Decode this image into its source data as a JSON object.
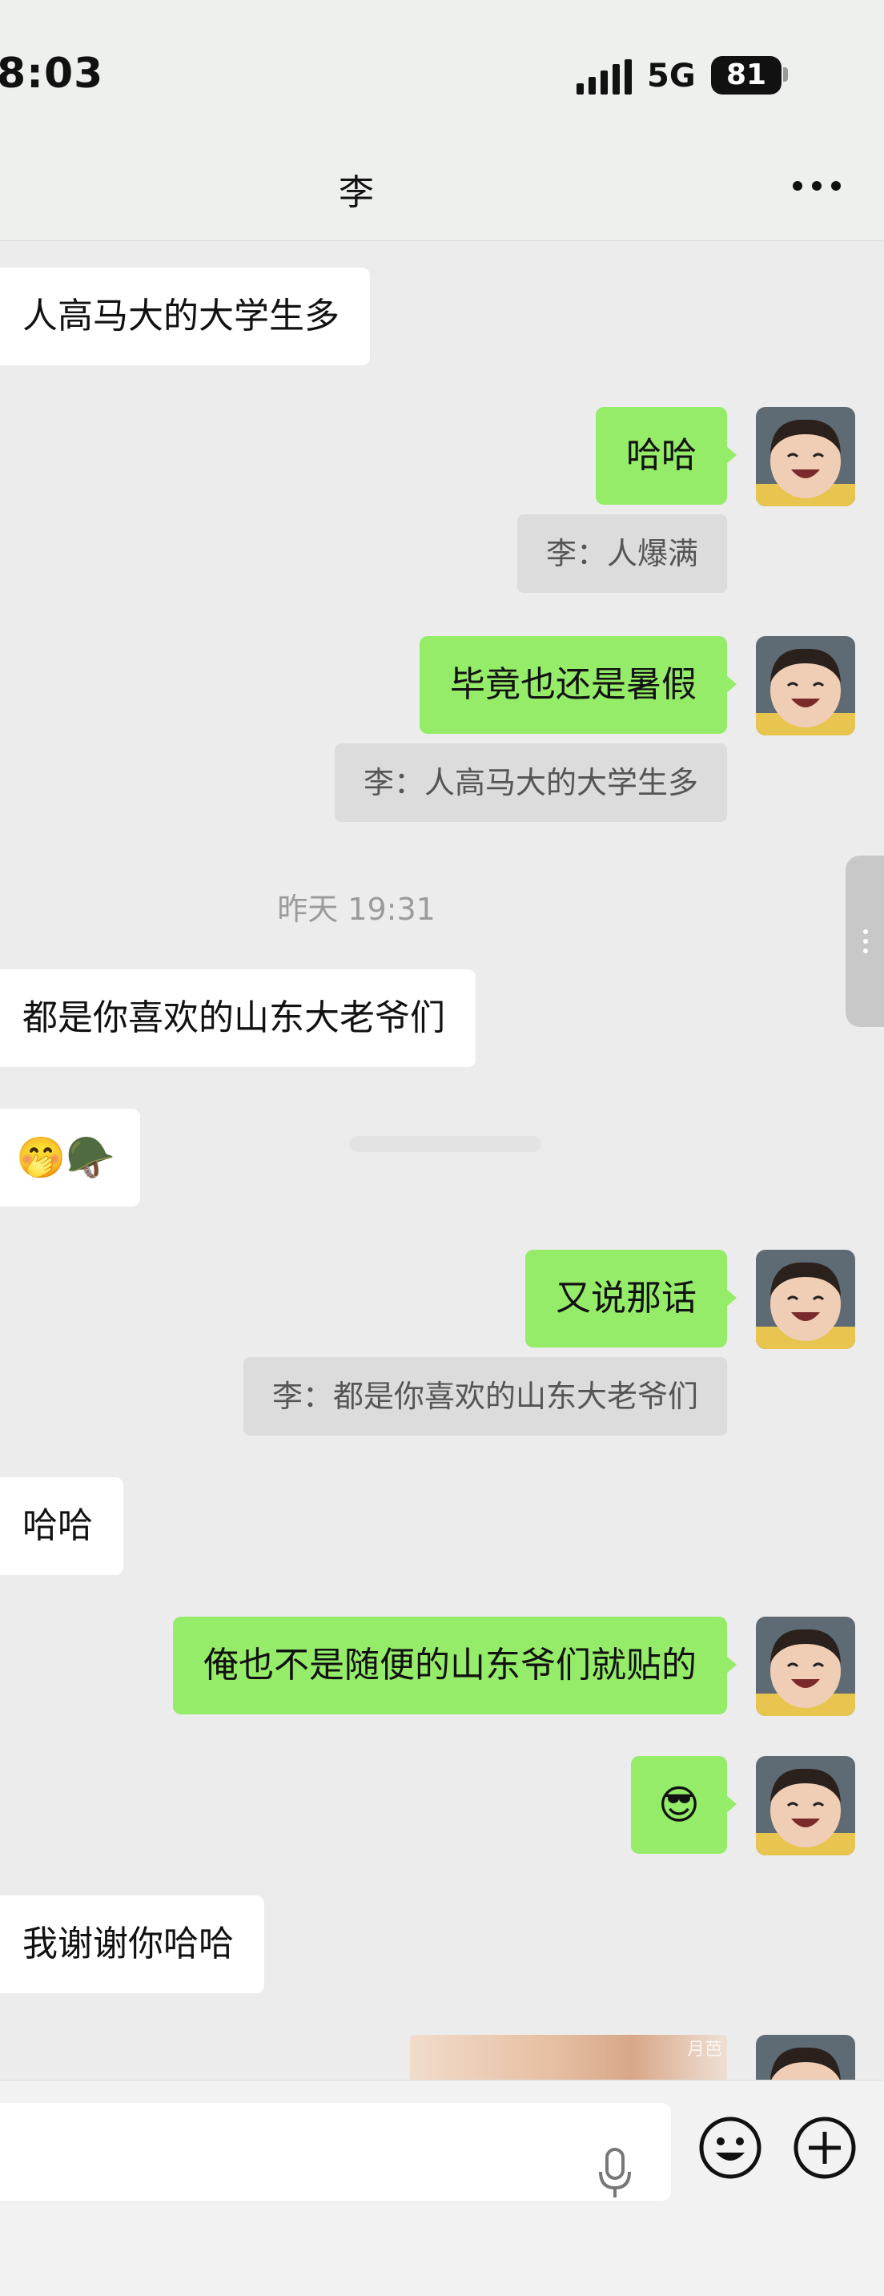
{
  "status_bar": {
    "time": "8:03",
    "network": "5G",
    "battery": "81"
  },
  "header": {
    "title": "李"
  },
  "messages": {
    "m1": "人高马大的大学生多",
    "m2": "哈哈",
    "m2_quote": "李：人爆满",
    "m3": "毕竟也还是暑假",
    "m3_quote": "李：人高马大的大学生多",
    "timestamp": "昨天 19:31",
    "m4": "都是你喜欢的山东大老爷们",
    "m5": "🤭🪖",
    "m6": "又说那话",
    "m6_quote": "李：都是你喜欢的山东大老爷们",
    "m7": "哈哈",
    "m8": "俺也不是随便的山东爷们就贴的",
    "m9": "😎",
    "m10": "我谢谢你哈哈",
    "photo_watermark": "月芭"
  },
  "colors": {
    "outgoing": "#95ec69",
    "incoming": "#ffffff",
    "background": "#ececec"
  },
  "icons": {
    "more": "more-dots-icon",
    "mic": "microphone-icon",
    "emoji": "emoji-icon",
    "plus": "plus-icon"
  }
}
